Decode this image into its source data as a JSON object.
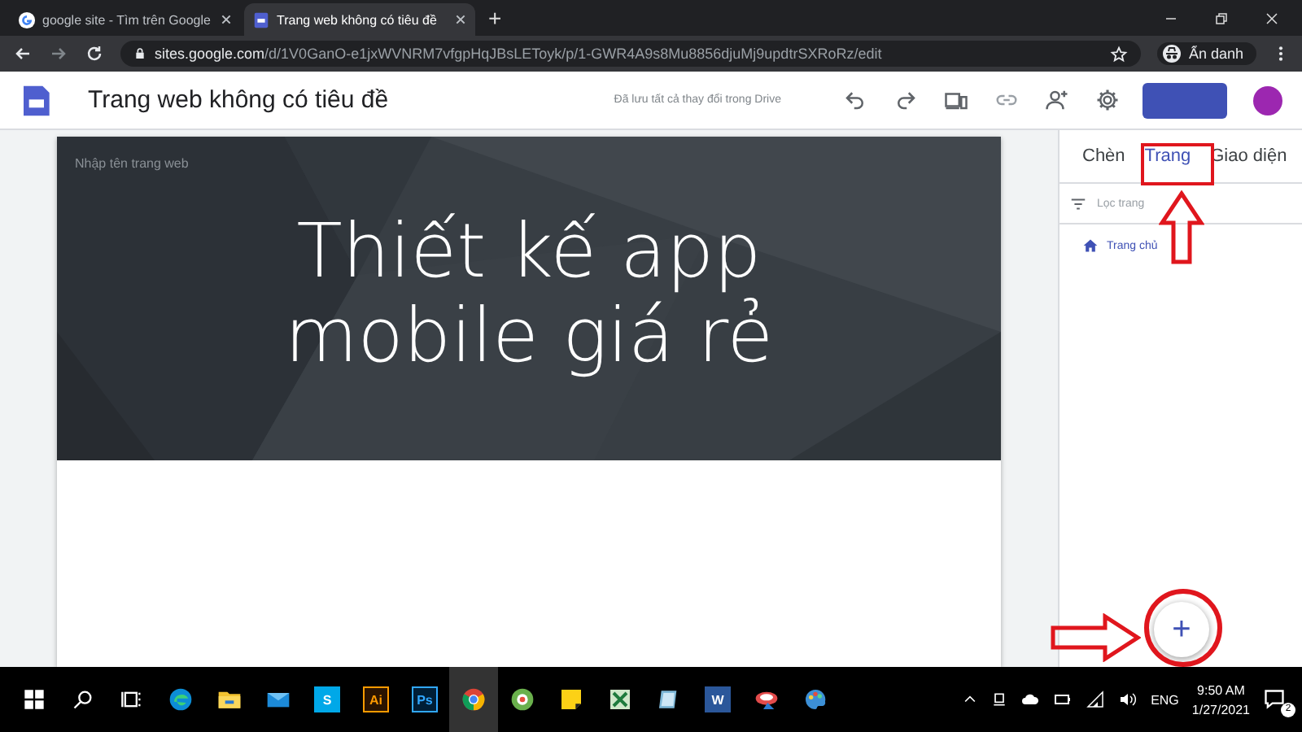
{
  "browser": {
    "tabs": [
      {
        "title": "google site - Tìm trên Google",
        "kind": "google",
        "selected": false
      },
      {
        "title": "Trang web không có tiêu đề",
        "kind": "sites",
        "selected": true
      }
    ],
    "new_tab": "+",
    "url_host": "sites.google.com",
    "url_path": "/d/1V0GanO-e1jxWVNRM7vfgpHqJBsLEToyk/p/1-GWR4A9s8Mu8856djuMj9updtrSXRoRz/edit",
    "profile": "Ẩn danh"
  },
  "header": {
    "title": "Trang web không có tiêu đề",
    "save_status": "Đã lưu tất cả thay đổi trong Drive"
  },
  "page": {
    "site_name_placeholder": "Nhập tên trang web",
    "title_lines": [
      "Thiết kế app",
      "mobile giá rẻ"
    ]
  },
  "panel": {
    "tabs": [
      {
        "label": "Chèn",
        "selected": false
      },
      {
        "label": "Trang",
        "selected": true
      },
      {
        "label": "Giao diện",
        "selected": false
      }
    ],
    "filter": {
      "placeholder": "Lọc trang"
    },
    "pages": [
      {
        "label": "Trang chủ",
        "selected": true
      }
    ],
    "add_button": "+"
  },
  "taskbar": {
    "apps": [
      {
        "kind": "edge"
      },
      {
        "kind": "folder"
      },
      {
        "kind": "mail"
      },
      {
        "kind": "skype",
        "label": "S"
      },
      {
        "kind": "ai",
        "label": "Ai"
      },
      {
        "kind": "ps",
        "label": "Ps"
      },
      {
        "kind": "chrome",
        "selected": true
      },
      {
        "kind": "green"
      },
      {
        "kind": "note"
      },
      {
        "kind": "sheet"
      },
      {
        "kind": "tablet"
      },
      {
        "kind": "word",
        "label": "W"
      },
      {
        "kind": "red"
      },
      {
        "kind": "paint"
      }
    ],
    "language": "ENG",
    "time": "9:50 AM",
    "date": "1/27/2021",
    "notifications": "2"
  }
}
